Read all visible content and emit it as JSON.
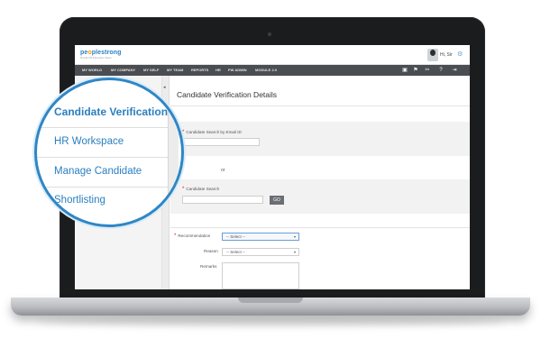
{
  "app": {
    "logo_prefix": "pe",
    "logo_o": "o",
    "logo_suffix": "plestrong",
    "tagline": "Simplify HR & Empower Teams",
    "greeting": "Hi, Sir"
  },
  "nav": {
    "items": [
      "MY WORLD",
      "MY COMPANY",
      "MY SELF",
      "MY TEAM",
      "REPORTS",
      "HR",
      "PW ADMIN",
      "MODULE 2.0"
    ]
  },
  "sidebar": {
    "items": [
      "Candidate Verification Details",
      "HR Workspace",
      "Manage Candidate",
      "Shortlisting"
    ],
    "collapse_glyph": "◂"
  },
  "page": {
    "title": "Candidate Verification Details",
    "email_label": "Candidate Search by Email ID",
    "or_text": "or",
    "search_label": "Candidate Search",
    "go_label": "GO",
    "recommendation_label": "Recommendation",
    "recommendation_value": "-- Select --",
    "reason_label": "Reason",
    "reason_value": "-- Select --",
    "remarks_label": "Remarks",
    "required_mark": "*"
  },
  "colors": {
    "accent": "#2f86c5",
    "navbar": "#4a4d52",
    "required": "#d62020"
  }
}
